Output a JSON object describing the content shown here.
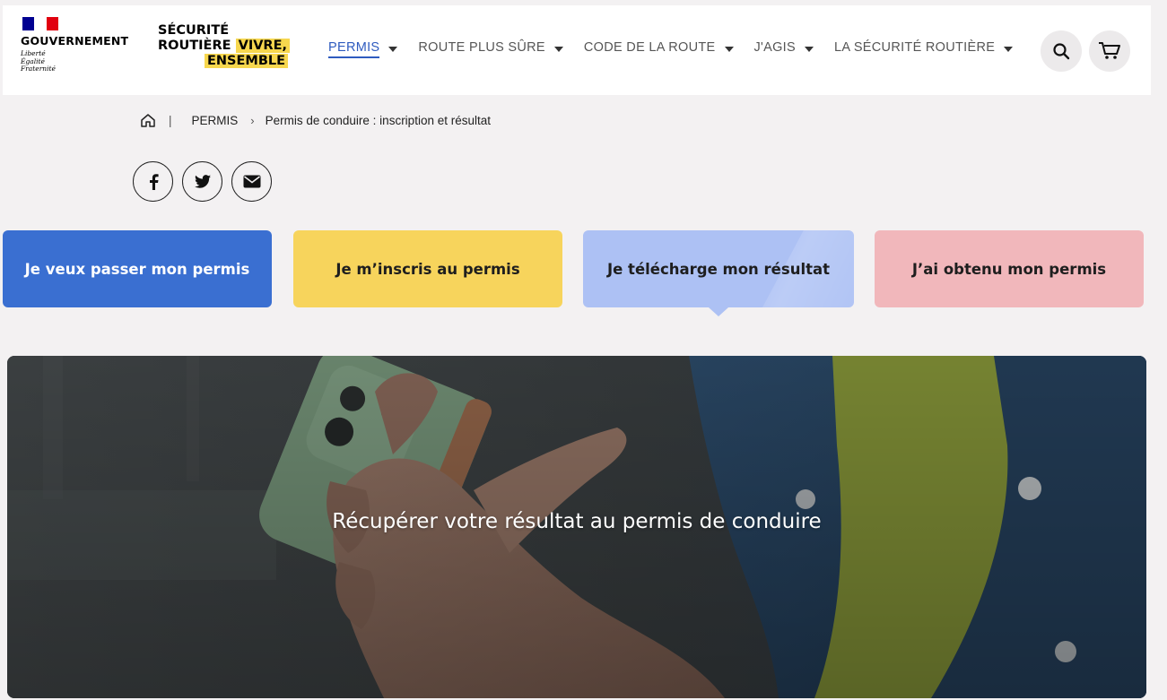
{
  "header": {
    "gov_title": "GOUVERNEMENT",
    "motto": [
      "Liberté",
      "Égalité",
      "Fraternité"
    ],
    "flag_colors": [
      "#000091",
      "#ffffff",
      "#e1000f"
    ],
    "site_logo": {
      "line1": "SÉCURITÉ",
      "line2a": "ROUTIÈRE",
      "line2b": "VIVRE,",
      "line3": "ENSEMBLE"
    },
    "nav": [
      {
        "label": "PERMIS",
        "active": true
      },
      {
        "label": "ROUTE PLUS SÛRE"
      },
      {
        "label": "CODE DE LA ROUTE"
      },
      {
        "label": "J'AGIS"
      },
      {
        "label": "LA SÉCURITÉ ROUTIÈRE"
      }
    ],
    "search_icon": "search-icon",
    "cart_icon": "cart-icon"
  },
  "breadcrumb": {
    "home_icon": "home-icon",
    "items": [
      "PERMIS",
      "Permis de conduire : inscription et résultat"
    ]
  },
  "share": [
    "facebook-icon",
    "twitter-icon",
    "email-icon"
  ],
  "tiles": [
    {
      "label": "Je veux passer mon permis",
      "color": "#3a6fd1"
    },
    {
      "label": "Je m’inscris au permis",
      "color": "#f7d45c"
    },
    {
      "label": "Je télécharge mon résultat",
      "color": "#adc1f4",
      "selected": true
    },
    {
      "label": "J’ai obtenu mon permis",
      "color": "#f1b7bb"
    }
  ],
  "hero": {
    "title": "Récupérer votre résultat au permis de conduire"
  },
  "colors": {
    "accent": "#2e5bbf",
    "highlight": "#f7d74e",
    "background": "#f3f1f2"
  }
}
